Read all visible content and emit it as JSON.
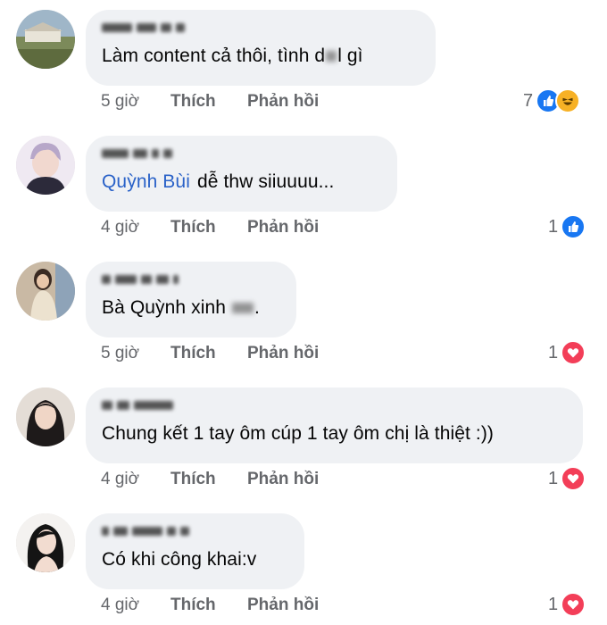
{
  "labels": {
    "like": "Thích",
    "reply": "Phản hồi"
  },
  "colors": {
    "bubble": "#eff1f4",
    "mention": "#2a62c8",
    "like_reaction": "#1877f2",
    "love_reaction": "#f33e58",
    "haha_reaction": "#f7b125"
  },
  "comments": [
    {
      "text": "Làm content cả thôi, tình d",
      "text_after": "l gì",
      "time": "5 giờ",
      "reaction_count": "7",
      "reactions": [
        "like-reaction-icon",
        "haha-reaction-icon"
      ]
    },
    {
      "mention": "Quỳnh Bùi",
      "text": "dễ thw siiuuuu...",
      "time": "4 giờ",
      "reaction_count": "1",
      "reactions": [
        "like-reaction-icon"
      ]
    },
    {
      "text": "Bà Quỳnh xinh",
      "text_after": ".",
      "time": "5 giờ",
      "reaction_count": "1",
      "reactions": [
        "love-reaction-icon"
      ]
    },
    {
      "text": "Chung kết 1 tay ôm cúp 1 tay ôm chị là thiệt :))",
      "time": "4 giờ",
      "reaction_count": "1",
      "reactions": [
        "love-reaction-icon"
      ]
    },
    {
      "text": "Có khi công khai:v",
      "time": "4 giờ",
      "reaction_count": "1",
      "reactions": [
        "love-reaction-icon"
      ]
    }
  ]
}
